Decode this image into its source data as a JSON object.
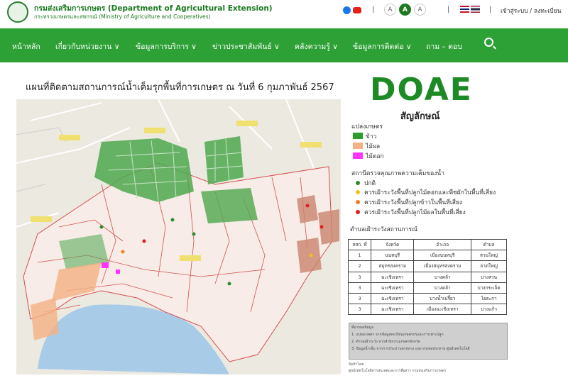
{
  "header": {
    "org_name": "กรมส่งเสริมการเกษตร (Department of Agricultural Extension)",
    "org_sub": "กระทรวงเกษตรและสหกรณ์ (Ministry of Agriculture and Cooperatives)",
    "font_sizes": [
      "A",
      "A",
      "A"
    ],
    "login": "เข้าสู่ระบบ / ลงทะเบียน",
    "colors": {
      "brand": "#1b7a1f",
      "nav": "#2da135"
    }
  },
  "nav": {
    "items": [
      "หน้าหลัก",
      "เกี่ยวกับหน่วยงาน ∨",
      "ข้อมูลการบริการ ∨",
      "ข่าวประชาสัมพันธ์ ∨",
      "คลังความรู้ ∨",
      "ข้อมูลการติดต่อ ∨",
      "ถาม – ตอบ"
    ]
  },
  "map": {
    "title": "แผนที่ติดตามสถานการณ์น้ำเค็มรุกพื้นที่การเกษตร ณ วันที่ 6 กุมภาพันธ์ 2567",
    "logo_text": "DOAE",
    "legend_title": "สัญลักษณ์",
    "plots_heading": "แปลงเกษตร",
    "plots": [
      {
        "label": "ข้าว",
        "color": "#2a9e2a"
      },
      {
        "label": "ไม้ผล",
        "color": "#f4b183"
      },
      {
        "label": "ไม้ดอก",
        "color": "#ff33ff"
      }
    ],
    "stations_heading": "สถานีตรวจคุณภาพความเค็มของน้ำ",
    "stations": [
      {
        "label": "ปกติ",
        "color": "#2e8b2e"
      },
      {
        "label": "ควรเฝ้าระวังพื้นที่ปลูกไม้ดอกและพืชผักในพื้นที่เสี่ยง",
        "color": "#f0c020"
      },
      {
        "label": "ควรเฝ้าระวังพื้นที่ปลูกข้าวในพื้นที่เสี่ยง",
        "color": "#f08020"
      },
      {
        "label": "ควรเฝ้าระวังพื้นที่ปลูกไม้ผลในพื้นที่เสี่ยง",
        "color": "#e02020"
      }
    ],
    "watch_heading": "ตำบลเฝ้าระวังสถานการณ์",
    "watch_table": {
      "headers": [
        "สสก. ที่",
        "จังหวัด",
        "อำเภอ",
        "ตำบล"
      ],
      "rows": [
        [
          "1",
          "นนทบุรี",
          "เมืองนนทบุรี",
          "สวนใหญ่"
        ],
        [
          "2",
          "สมุทรสงคราม",
          "เมืองสมุทรสงคราม",
          "ลาดใหญ่"
        ],
        [
          "3",
          "ฉะเชิงเทรา",
          "บางคล้า",
          "บางสวน"
        ],
        [
          "3",
          "ฉะเชิงเทรา",
          "บางคล้า",
          "บางกระเจ็ด"
        ],
        [
          "3",
          "ฉะเชิงเทรา",
          "บางน้ำเปรี้ยว",
          "โยธะกา"
        ],
        [
          "3",
          "ฉะเชิงเทรา",
          "เมืองฉะเชิงเทรา",
          "บางแก้ว"
        ]
      ]
    },
    "source_heading": "ที่มาของข้อมูล",
    "sources": [
      "1. แปลงเกษตร จากข้อมูลทะเบียนเกษตรกรและการเพาะปลูก",
      "2. ตำบลเฝ้าระวัง จากสำนักงานเกษตรจังหวัด",
      "3. ข้อมูลน้ำเค็ม จากการประปานครหลวง และกรมชลประทาน ศูนย์เทคโนโลยี"
    ],
    "credit": [
      "จัดทำโดย",
      "ศูนย์เทคโนโลยีสารสนเทศและการสื่อสาร กรมส่งเสริมการเกษตร"
    ]
  }
}
